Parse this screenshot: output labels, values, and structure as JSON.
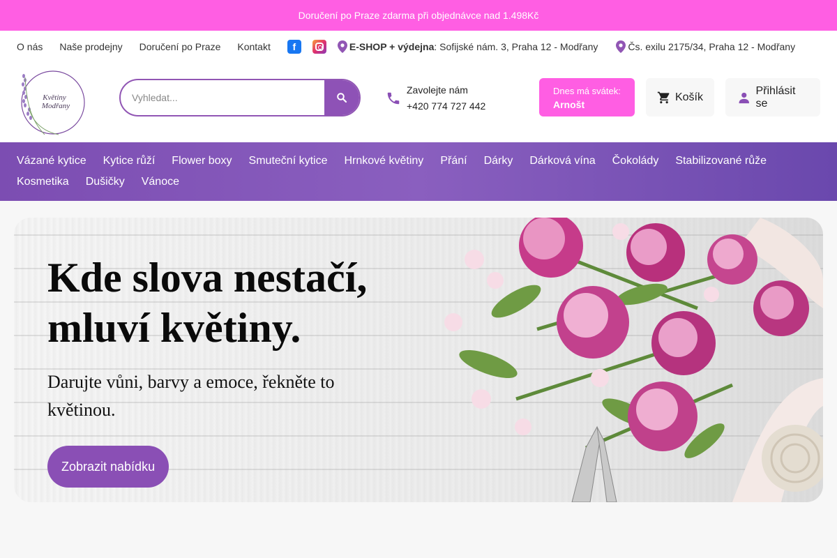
{
  "promo": {
    "text": "Doručení po Praze zdarma při objednávce nad 1.498Kč"
  },
  "topbar": {
    "links": [
      "O nás",
      "Naše prodejny",
      "Doručení po Praze",
      "Kontakt"
    ],
    "social": [
      {
        "name": "facebook-icon",
        "glyph": "f"
      },
      {
        "name": "instagram-icon"
      }
    ],
    "address1": {
      "label": "E-SHOP + výdejna",
      "text": ": Sofijské nám. 3, Praha 12 - Modřany"
    },
    "address2": {
      "text": "Čs. exilu 2175/34, Praha 12 - Modřany"
    }
  },
  "header": {
    "logo": {
      "line1": "Květiny",
      "line2": "Modřany"
    },
    "search": {
      "placeholder": "Vyhledat..."
    },
    "phone": {
      "label": "Zavolejte nám",
      "number": "+420 774 727 442"
    },
    "svatek": {
      "label": "Dnes má svátek:",
      "name": "Arnošt"
    },
    "cart_label": "Košík",
    "login_label": "Přihlásit se"
  },
  "nav": {
    "items": [
      "Vázané kytice",
      "Kytice růží",
      "Flower boxy",
      "Smuteční kytice",
      "Hrnkové květiny",
      "Přání",
      "Dárky",
      "Dárková vína",
      "Čokolády",
      "Stabilizované růže",
      "Kosmetika",
      "Dušičky",
      "Vánoce"
    ]
  },
  "hero": {
    "title": "Kde slova nestačí, mluví květiny.",
    "subtitle": "Darujte vůni, barvy a emoce, řekněte to květinou.",
    "cta": "Zobrazit nabídku"
  },
  "colors": {
    "pink": "#ff5ee3",
    "purple": "#8a4fb5",
    "nav": "#7c4db2"
  }
}
